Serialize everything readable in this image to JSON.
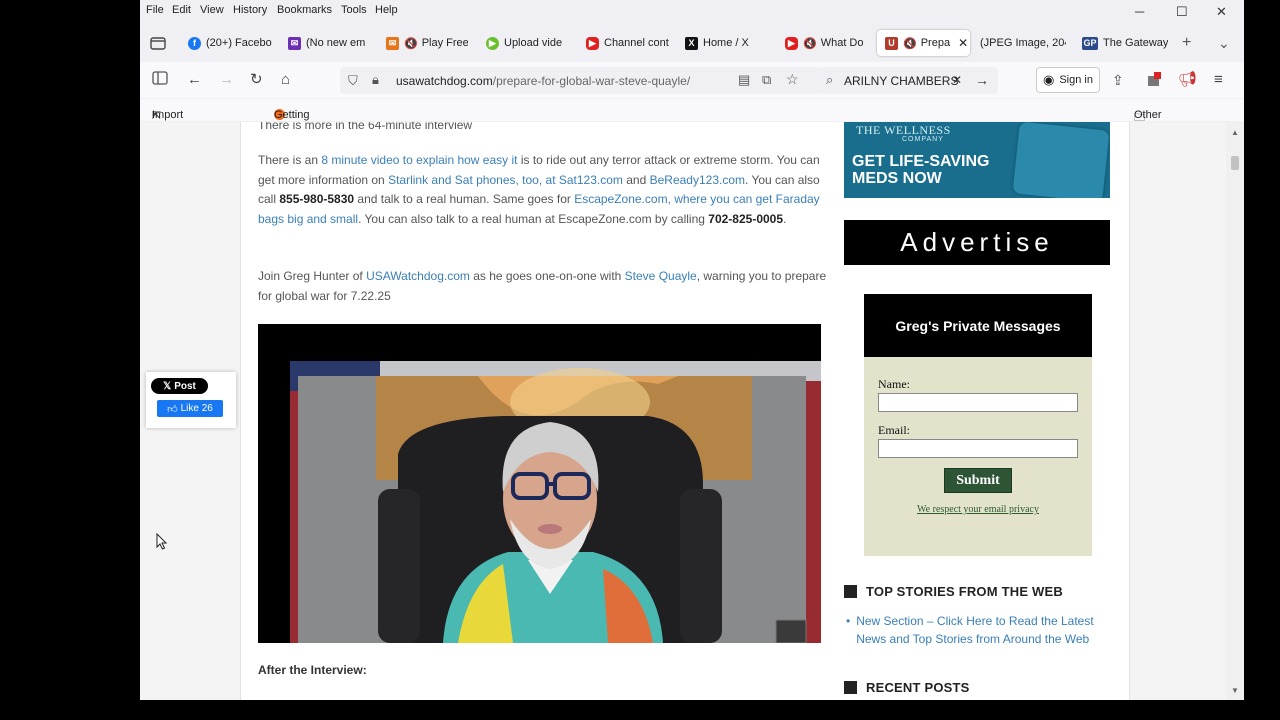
{
  "menu": [
    "File",
    "Edit",
    "View",
    "History",
    "Bookmarks",
    "Tools",
    "Help"
  ],
  "window_controls": {
    "minimize": "─",
    "maximize": "☐",
    "close": "✕"
  },
  "tabs": [
    {
      "label": "(20+) Facebo",
      "fav": "f",
      "color": "#1877f2"
    },
    {
      "label": "(No new em",
      "fav": "✉",
      "color": "#6b2fb3"
    },
    {
      "label": "Play Free",
      "fav": "✉",
      "color": "#e8751a"
    },
    {
      "label": "Upload vide",
      "fav": "▶",
      "color": "#6bbf2d"
    },
    {
      "label": "Channel cont",
      "fav": "▶",
      "color": "#e0201e"
    },
    {
      "label": "Home / X",
      "fav": "X",
      "color": "#111111"
    },
    {
      "label": "What Do",
      "fav": "▶",
      "color": "#e0201e"
    },
    {
      "label": "Prepa",
      "fav": "U",
      "color": "#b23b2c"
    },
    {
      "label": "(JPEG Image, 204",
      "fav": "",
      "color": "#ffffff"
    },
    {
      "label": "The Gateway",
      "fav": "GP",
      "color": "#2a4a8c"
    }
  ],
  "active_tab_close": "✕",
  "new_tab": "+",
  "tab_list": "⌄",
  "url": {
    "domain": "usawatchdog.com",
    "path": "/prepare-for-global-war-steve-quayle/"
  },
  "search_value": "ARILNY CHAMBERS",
  "search_clear": "✕",
  "search_go": "→",
  "signin_label": "Sign in",
  "bookmarks": {
    "import": "Import bookmarks...",
    "getting_started": "Getting Started",
    "other": "Other Bookmarks"
  },
  "article": {
    "cut_line": "There is more in the 64-minute interview",
    "p1": {
      "t1": "There is an ",
      "l1": "8 minute video to explain how easy it",
      "t2": " is to ride out any terror attack or extreme storm.  You can get more information on ",
      "l2": "Starlink and Sat phones, too, at Sat123.com",
      "t3": " and ",
      "l3": "BeReady123.com",
      "t4": ".  You can also call ",
      "b1": "855-980-5830",
      "t5": " and talk to a real human.  Same goes for ",
      "l4": "EscapeZone.com, where you can get Faraday bags big and small",
      "t6": ".  You can also talk to a real human at EscapeZone.com by calling ",
      "b2": "702-825-0005",
      "t7": "."
    },
    "p2": {
      "t1": "Join Greg Hunter of ",
      "l1": "USAWatchdog.com",
      "t2": " as he goes one-on-one with ",
      "l2": "Steve Quayle",
      "t3": ", warning you to prepare for global war for 7.22.25"
    },
    "after": "After the Interview:"
  },
  "social": {
    "post": "Post",
    "like": "Like 26"
  },
  "sidebar": {
    "wellness_brand": "THE WELLNESS",
    "wellness_sub": "COMPANY",
    "wellness_line1": "GET LIFE-SAVING",
    "wellness_line2": "MEDS NOW",
    "advertise": "Advertise",
    "gpm_title": "Greg's Private Messages",
    "name_label": "Name:",
    "email_label": "Email:",
    "submit": "Submit",
    "privacy": "We respect your email privacy",
    "top_stories": "TOP STORIES FROM THE WEB",
    "top_link": "New Section – Click Here to Read the Latest News and Top Stories from Around the Web",
    "recent": "RECENT POSTS"
  }
}
